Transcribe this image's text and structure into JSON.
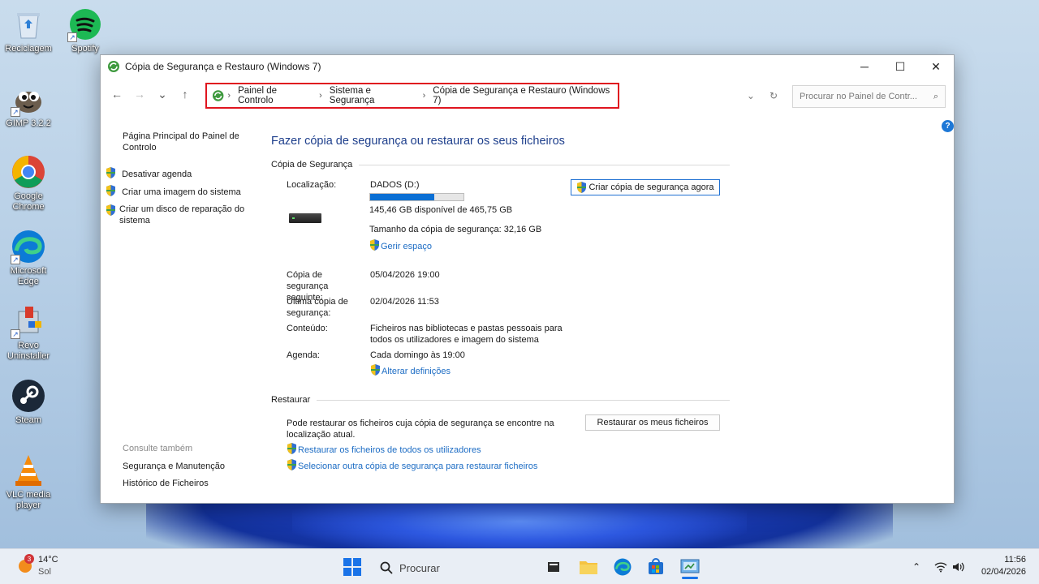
{
  "desktop": {
    "icons": [
      {
        "label": "Reciclagem",
        "name": "recycle-bin-icon"
      },
      {
        "label": "Spotify",
        "name": "spotify-icon"
      },
      {
        "label": "GIMP 3.2.2",
        "name": "gimp-icon"
      },
      {
        "label": "Google Chrome",
        "name": "chrome-icon"
      },
      {
        "label": "Microsoft Edge",
        "name": "edge-icon"
      },
      {
        "label": "Revo Uninstaller",
        "name": "revo-uninstaller-icon"
      },
      {
        "label": "Steam",
        "name": "steam-icon"
      },
      {
        "label": "VLC media player",
        "name": "vlc-icon"
      }
    ]
  },
  "window": {
    "title": "Cópia de Segurança e Restauro (Windows 7)",
    "controls": {
      "minimize": "─",
      "maximize": "☐",
      "close": "✕"
    }
  },
  "nav": {
    "back": "←",
    "forward": "→",
    "recent": "⌄",
    "up": "↑",
    "breadcrumb": [
      "Painel de Controlo",
      "Sistema e Segurança",
      "Cópia de Segurança e Restauro (Windows 7)"
    ],
    "breadcrumb_sep": "›",
    "dropdown": "⌄",
    "refresh": "↻",
    "search_placeholder": "Procurar no Painel de Contr...",
    "search_icon": "⌕"
  },
  "help": "?",
  "sidebar": {
    "home_link": "Página Principal do Painel de Controlo",
    "tasks": [
      "Desativar agenda",
      "Criar uma imagem do sistema",
      "Criar um disco de reparação do sistema"
    ],
    "see_also_heading": "Consulte também",
    "see_also": [
      "Segurança e Manutenção",
      "Histórico de Ficheiros"
    ]
  },
  "main": {
    "title": "Fazer cópia de segurança ou restaurar os seus ficheiros",
    "backup_section": "Cópia de Segurança",
    "location_label": "Localização:",
    "location_value": "DADOS (D:)",
    "disk_used_fraction": 0.69,
    "disk_free": "145,46 GB disponível de 465,75 GB",
    "backup_size": "Tamanho da cópia de segurança: 32,16 GB",
    "manage_space": "Gerir espaço",
    "backup_now_button": "Criar cópia de segurança agora",
    "next_label": "Cópia de segurança seguinte:",
    "next_value": "05/04/2026 19:00",
    "last_label": "Última cópia de segurança:",
    "last_value": "02/04/2026 11:53",
    "contents_label": "Conteúdo:",
    "contents_value": "Ficheiros nas bibliotecas e pastas pessoais para todos os utilizadores e imagem do sistema",
    "schedule_label": "Agenda:",
    "schedule_value": "Cada domingo às 19:00",
    "change_settings": "Alterar definições",
    "restore_section": "Restaurar",
    "restore_text": "Pode restaurar os ficheiros cuja cópia de segurança se encontre na localização atual.",
    "restore_button": "Restaurar os meus ficheiros",
    "restore_all_users": "Restaurar os ficheiros de todos os utilizadores",
    "select_other_backup": "Selecionar outra cópia de segurança para restaurar ficheiros"
  },
  "taskbar": {
    "weather_temp": "14°C",
    "weather_desc": "Sol",
    "weather_badge": "3",
    "search_label": "Procurar",
    "tray_chevron": "⌃",
    "time": "11:56",
    "date": "02/04/2026"
  },
  "colors": {
    "accent": "#0a6fd4",
    "title_blue": "#1e3f8c",
    "link_blue": "#1c6cc4",
    "highlight_red": "#e0151f"
  }
}
